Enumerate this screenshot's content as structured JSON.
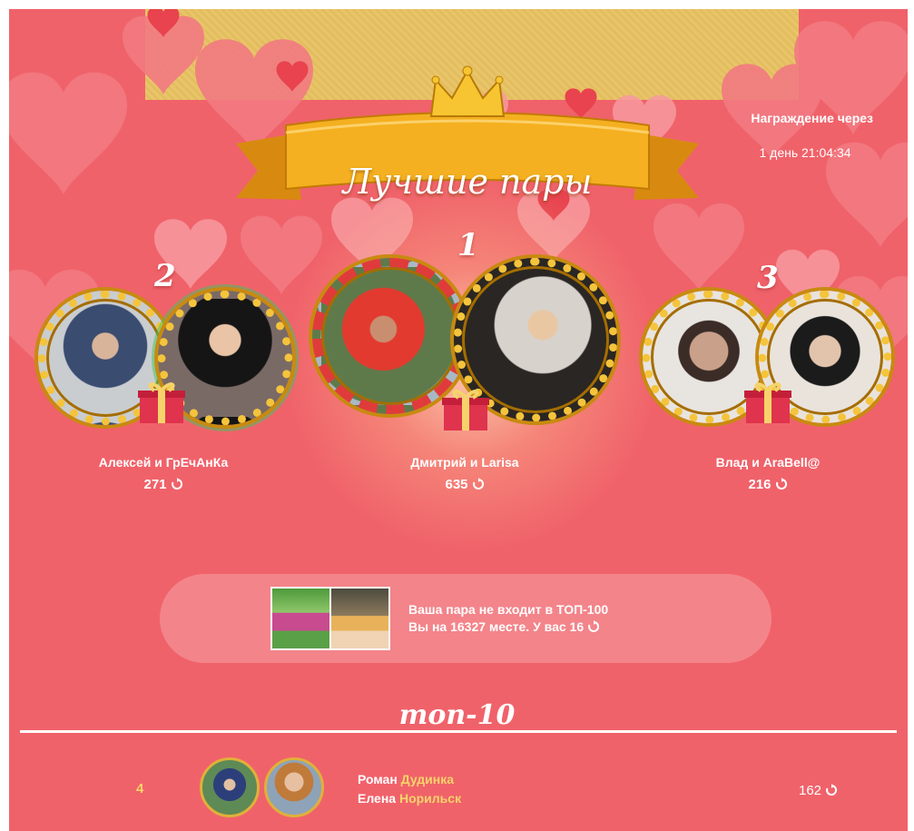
{
  "header": {
    "title": "Лучшие пары",
    "award_label": "Награждение через",
    "award_timer": "1 день 21:04:34"
  },
  "podium": [
    {
      "rank": "2",
      "names": "Алексей и ГрЕчАнКа",
      "score": "271"
    },
    {
      "rank": "1",
      "names": "Дмитрий и Larisa",
      "score": "635"
    },
    {
      "rank": "3",
      "names": "Влад и AraBell@",
      "score": "216"
    }
  ],
  "your_pair": {
    "line1": "Ваша пара не входит в ТОП-100",
    "line2": "Вы на 16327 месте. У вас 16"
  },
  "top10": {
    "title": "топ-10",
    "rows": [
      {
        "rank": "4",
        "name1": "Роман",
        "city1": "Дудинка",
        "name2": "Елена",
        "city2": "Норильск",
        "score": "162"
      }
    ]
  },
  "icons": {
    "score": "refresh-icon",
    "gift": "gift-icon",
    "crown": "crown-icon"
  },
  "colors": {
    "background": "#f0626a",
    "gold": "#f4c43c",
    "accent_text": "#f6d36a"
  }
}
